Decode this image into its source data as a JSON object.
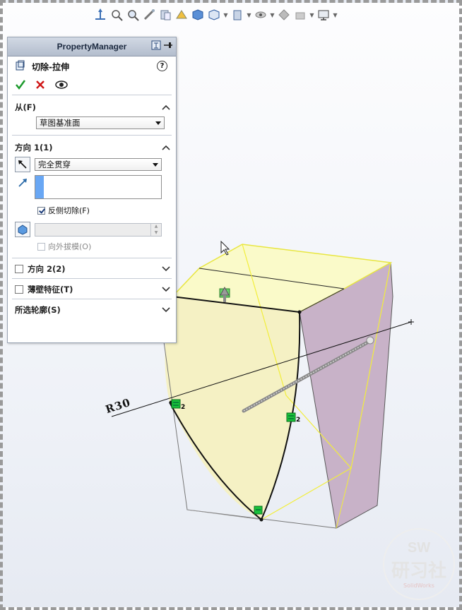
{
  "property_manager": {
    "title": "PropertyManager",
    "feature_name": "切除-拉伸",
    "help_label": "?",
    "from_section": {
      "header": "从(F)",
      "value": "草图基准面"
    },
    "direction1": {
      "header": "方向 1(1)",
      "end_condition": "完全贯穿",
      "flip_side_label": "反侧切除(F)",
      "flip_side_checked": true,
      "draft_outward_label": "向外拔模(O)"
    },
    "direction2": {
      "header": "方向 2(2)"
    },
    "thin_feature": {
      "header": "薄壁特征(T)"
    },
    "selected_contours": {
      "header": "所选轮廓(S)"
    }
  },
  "graphics": {
    "dimension_label": "R30",
    "relation_count_a": "2",
    "relation_count_b": "2"
  },
  "watermark": {
    "line1": "SW",
    "line2": "研习社",
    "line3": "SolidWorks"
  },
  "colors": {
    "face_yellow": "#f5f1c4",
    "face_top_yellow": "#fafac9",
    "face_purple": "#c8b2c8",
    "edge_yellow": "#f2ee3a",
    "arrow_red": "#e0121c",
    "pm_title": "#b8c2d2"
  },
  "icons": {
    "toolbar": [
      "view-orientation-icon",
      "zoom-to-fit-icon",
      "zoom-area-icon",
      "section-view-icon",
      "previous-view-icon",
      "dynamic-annotation-icon",
      "standard-views-icon",
      "display-style-icon",
      "hide-show-icon",
      "edit-appearance-icon",
      "apply-scene-icon",
      "view-settings-icon"
    ]
  }
}
